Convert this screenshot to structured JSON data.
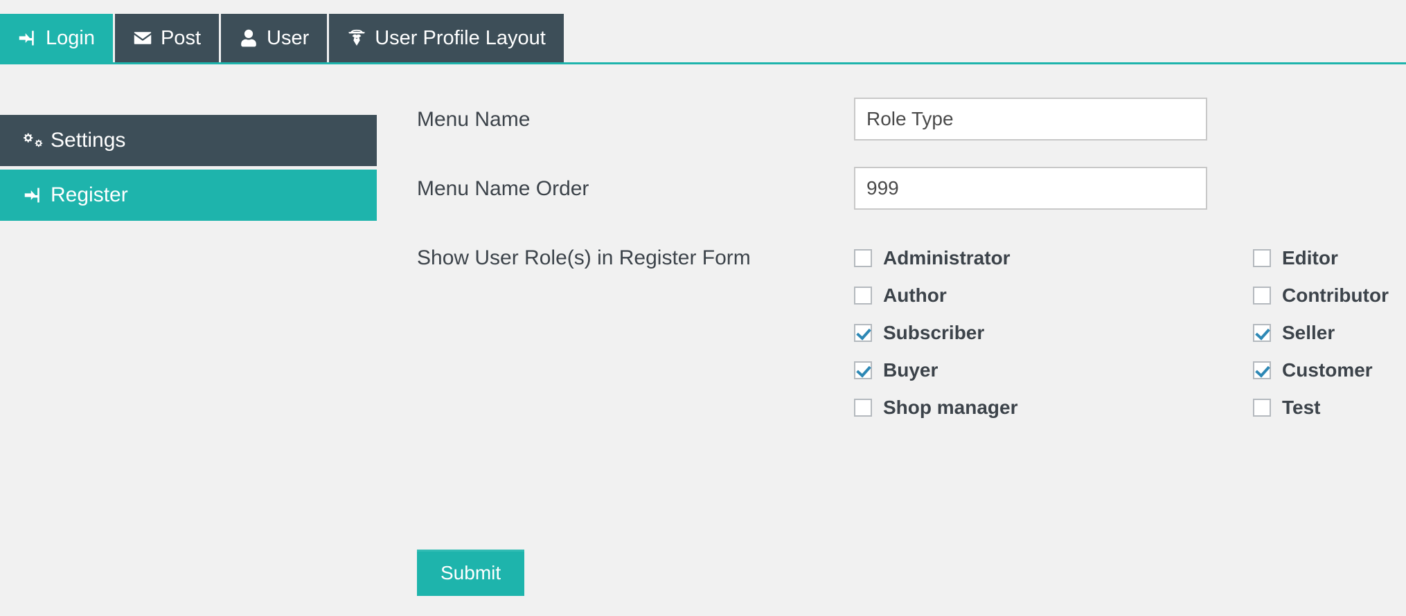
{
  "theme": {
    "accent": "#1eb4ac",
    "dark": "#3d4e58",
    "page_bg": "#f1f1f1",
    "check_color": "#2d88b5",
    "text": "#3c434a"
  },
  "nav": {
    "tabs": [
      {
        "label": "Login",
        "icon": "sign-in-icon",
        "active": true
      },
      {
        "label": "Post",
        "icon": "envelope-icon",
        "active": false
      },
      {
        "label": "User",
        "icon": "user-icon",
        "active": false
      },
      {
        "label": "User Profile Layout",
        "icon": "user-secret-icon",
        "active": false
      }
    ]
  },
  "sidebar": {
    "items": [
      {
        "label": "Settings",
        "icon": "cogs-icon",
        "state": "dark"
      },
      {
        "label": "Register",
        "icon": "sign-in-icon",
        "state": "teal"
      }
    ]
  },
  "form": {
    "menu_name": {
      "label": "Menu Name",
      "value": "Role Type",
      "placeholder": "Menu Name"
    },
    "menu_name_order": {
      "label": "Menu Name Order",
      "value": "999",
      "placeholder": "Menu Name Order"
    },
    "roles": {
      "label": "Show User Role(s) in Register Form",
      "left_column": [
        {
          "label": "Administrator",
          "checked": false
        },
        {
          "label": "Author",
          "checked": false
        },
        {
          "label": "Subscriber",
          "checked": true
        },
        {
          "label": "Buyer",
          "checked": true
        },
        {
          "label": "Shop manager",
          "checked": false
        }
      ],
      "right_column": [
        {
          "label": "Editor",
          "checked": false
        },
        {
          "label": "Contributor",
          "checked": false
        },
        {
          "label": "Seller",
          "checked": true
        },
        {
          "label": "Customer",
          "checked": true
        },
        {
          "label": "Test",
          "checked": false
        }
      ]
    },
    "submit_label": "Submit"
  }
}
